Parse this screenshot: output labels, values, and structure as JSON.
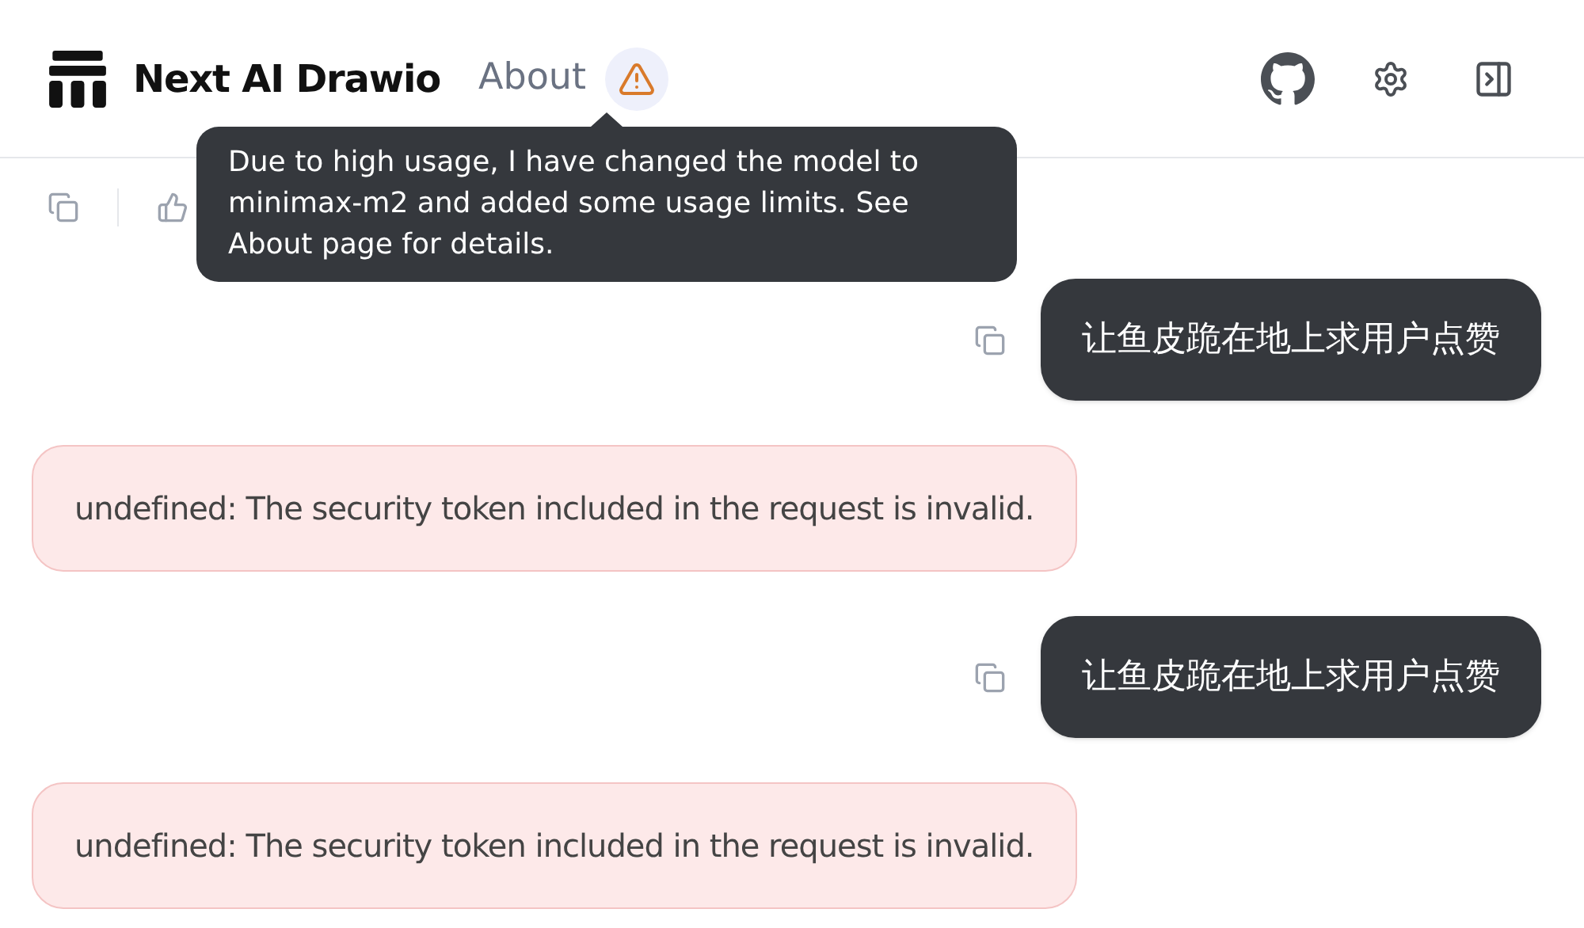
{
  "header": {
    "title": "Next AI Drawio",
    "nav_link": "About"
  },
  "tooltip": {
    "text": "Due to high usage, I have changed the model to minimax-m2 and added some usage limits. See About page for details."
  },
  "messages": [
    {
      "kind": "user",
      "text": "让鱼皮跪在地上求用户点赞"
    },
    {
      "kind": "error",
      "text": "undefined: The security token included in the request is invalid."
    },
    {
      "kind": "user",
      "text": "让鱼皮跪在地上求用户点赞"
    },
    {
      "kind": "error",
      "text": "undefined: The security token included in the request is invalid."
    }
  ]
}
